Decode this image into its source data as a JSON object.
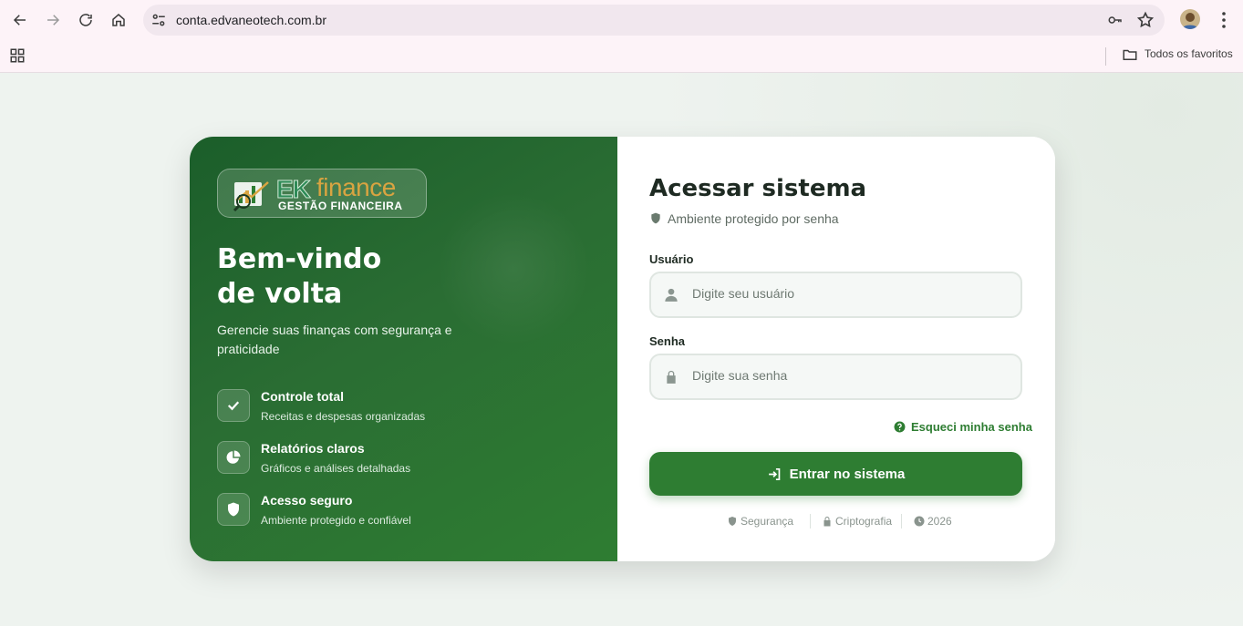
{
  "browser": {
    "url": "conta.edvaneotech.com.br",
    "bookmarks_folder": "Todos os favoritos"
  },
  "brand": {
    "logo_ek": "EK",
    "logo_finance": "finance",
    "logo_subtitle": "GESTÃO FINANCEIRA",
    "primary_color": "#2e7d32",
    "gold_color": "#d9a441"
  },
  "hero": {
    "title_line1": "Bem-vindo",
    "title_line2": "de volta",
    "tagline": "Gerencie suas finanças com segurança e praticidade",
    "features": [
      {
        "icon": "check-icon",
        "title": "Controle total",
        "description": "Receitas e despesas organizadas"
      },
      {
        "icon": "pie-chart-icon",
        "title": "Relatórios claros",
        "description": "Gráficos e análises detalhadas"
      },
      {
        "icon": "shield-icon",
        "title": "Acesso seguro",
        "description": "Ambiente protegido e confiável"
      }
    ]
  },
  "login": {
    "title": "Acessar sistema",
    "subtitle": "Ambiente protegido por senha",
    "username_label": "Usuário",
    "username_placeholder": "Digite seu usuário",
    "password_label": "Senha",
    "password_placeholder": "Digite sua senha",
    "forgot_link": "Esqueci minha senha",
    "submit_label": "Entrar no sistema"
  },
  "footer": {
    "items": [
      "Segurança",
      "Criptografia",
      "2026"
    ]
  }
}
